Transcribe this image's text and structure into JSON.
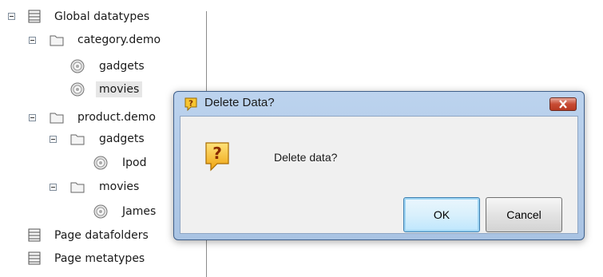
{
  "tree": {
    "root": {
      "label": "Global datatypes"
    },
    "category_demo": {
      "label": "category.demo",
      "children": [
        "gadgets",
        "movies"
      ]
    },
    "product_demo": {
      "label": "product.demo"
    },
    "product_gadgets": {
      "label": "gadgets",
      "children": [
        "Ipod"
      ]
    },
    "product_movies": {
      "label": "movies",
      "children": [
        "James"
      ]
    },
    "page_datafolders": {
      "label": "Page datafolders"
    },
    "page_metatypes": {
      "label": "Page metatypes"
    }
  },
  "dialog": {
    "title": "Delete Data?",
    "message": "Delete data?",
    "ok_label": "OK",
    "cancel_label": "Cancel"
  },
  "colors": {
    "titlebar": "#bcd3ee",
    "close_button": "#c74a33",
    "client_bg": "#f0f0f0",
    "question_icon": "#f0b820"
  },
  "icons": [
    "expand-collapse-icon",
    "database-icon",
    "folder-icon",
    "disc-icon",
    "question-icon",
    "close-icon"
  ]
}
